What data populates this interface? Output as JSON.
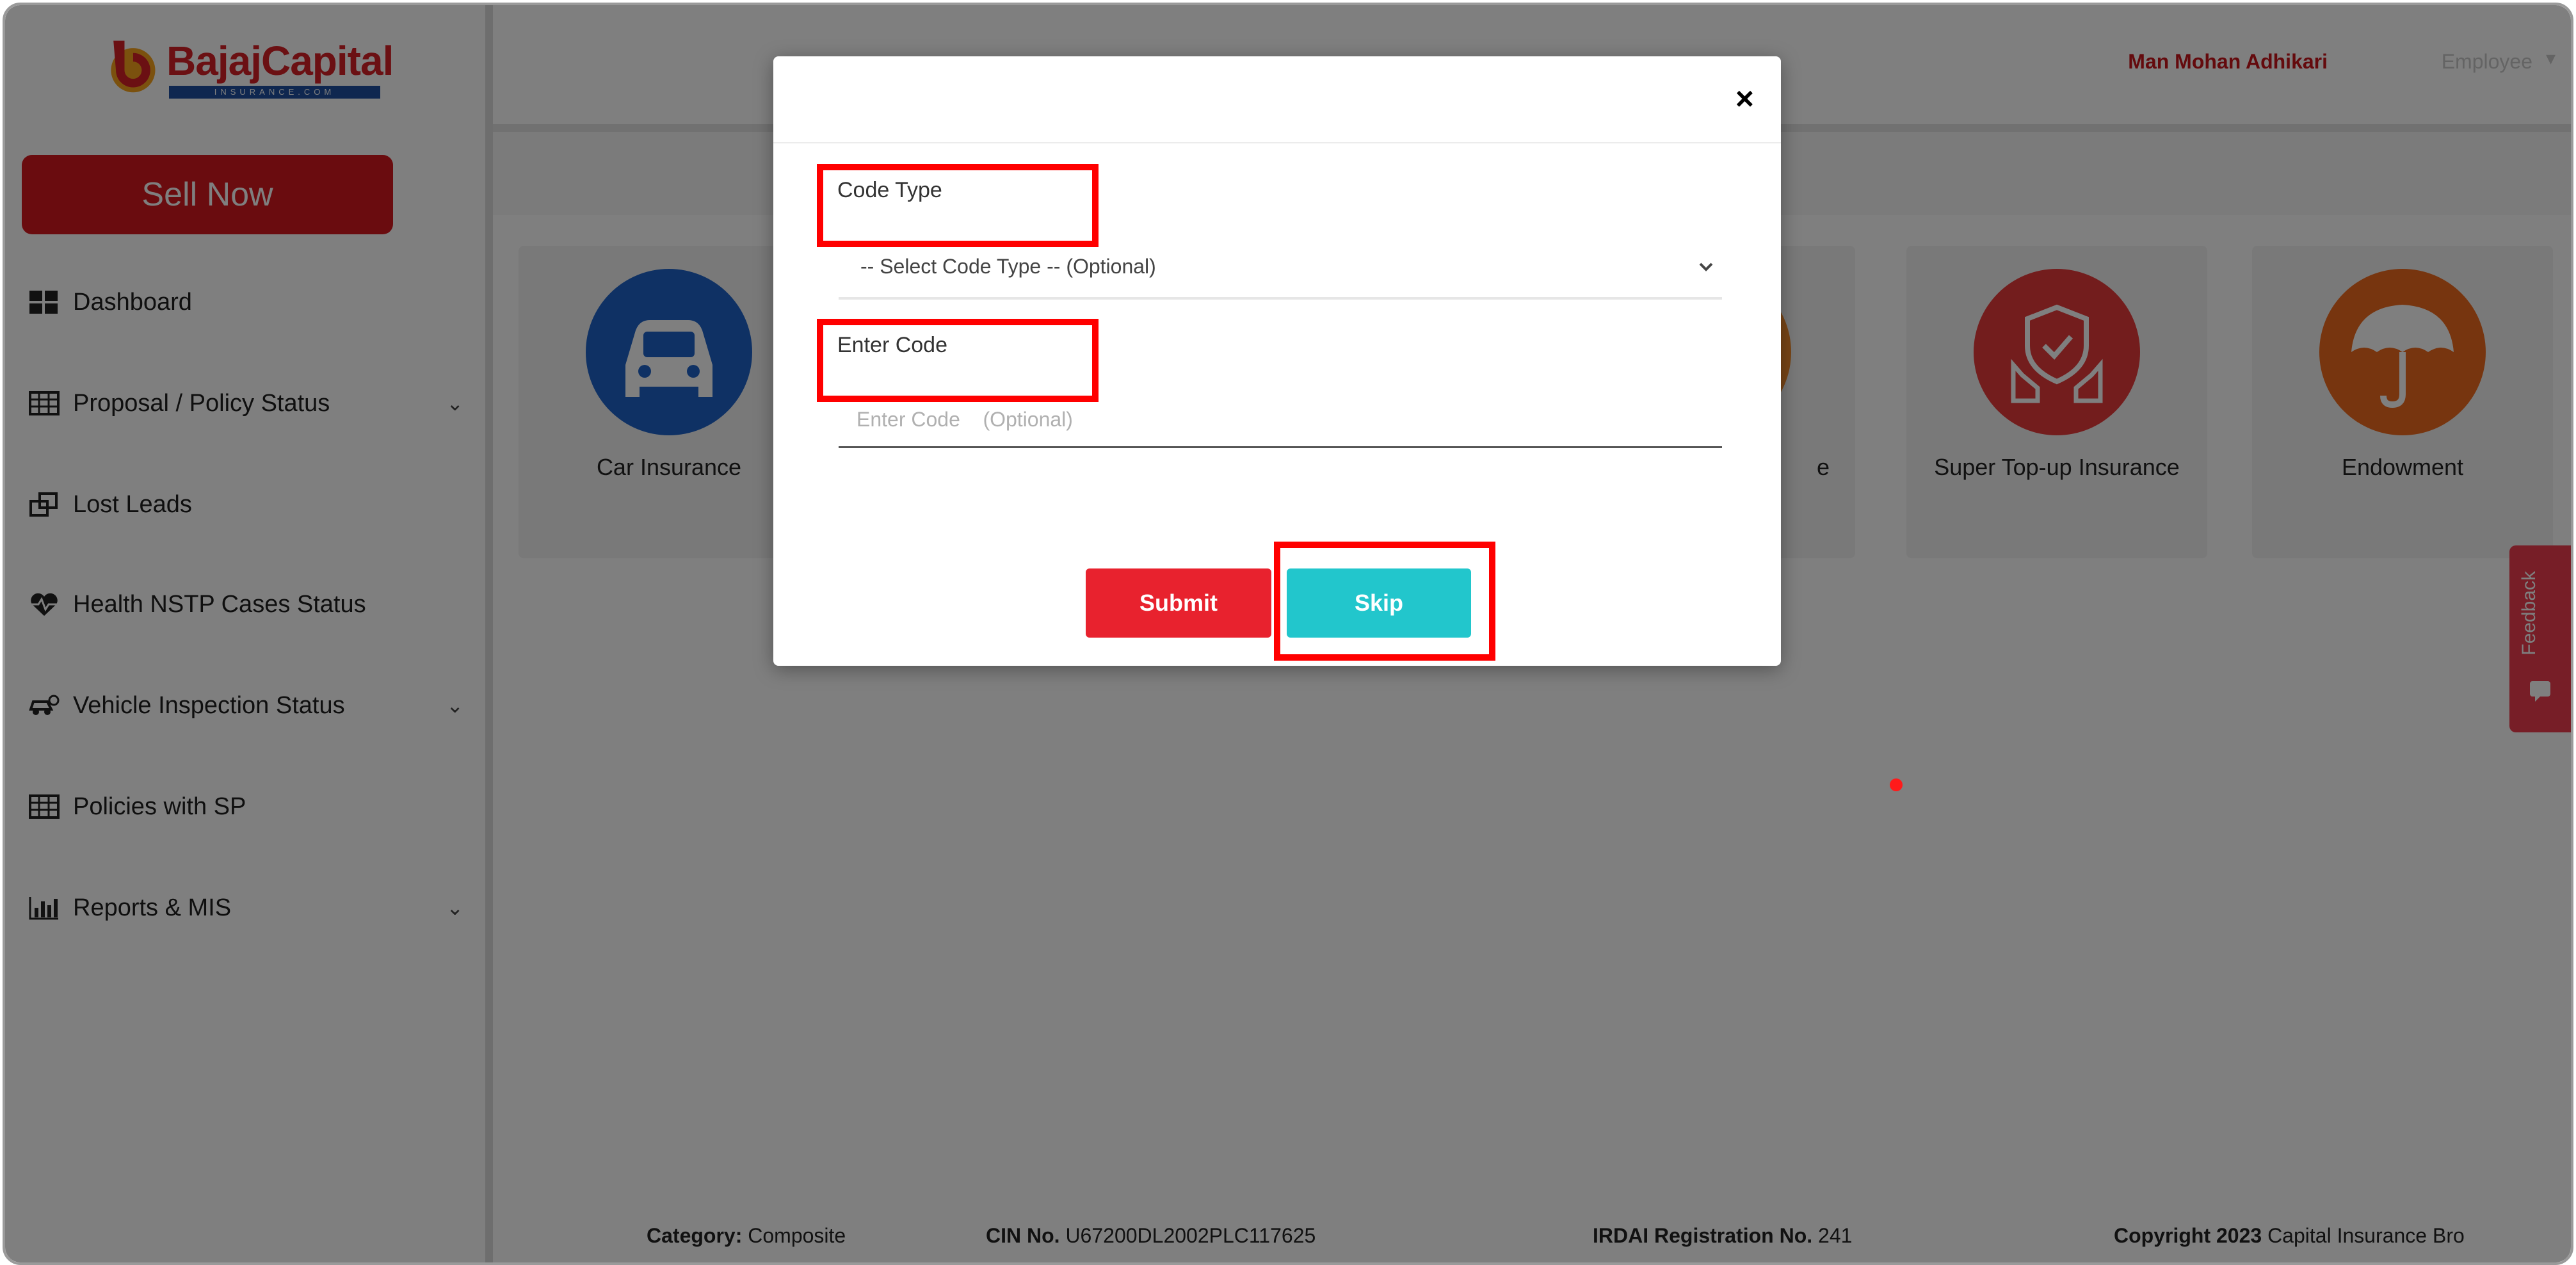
{
  "brand": {
    "name": "BajajCapital",
    "sub": "INSURANCE.COM",
    "color": "#d62027"
  },
  "sidebar": {
    "sell_now": "Sell Now",
    "items": [
      {
        "label": "Dashboard",
        "icon": "dashboard-icon",
        "has_chevron": false
      },
      {
        "label": "Proposal / Policy Status",
        "icon": "table-icon",
        "has_chevron": true
      },
      {
        "label": "Lost Leads",
        "icon": "copy-icon",
        "has_chevron": false
      },
      {
        "label": "Health NSTP Cases Status",
        "icon": "heart-pulse-icon",
        "has_chevron": false
      },
      {
        "label": "Vehicle Inspection Status",
        "icon": "car-search-icon",
        "has_chevron": true
      },
      {
        "label": "Policies with SP",
        "icon": "table-icon",
        "has_chevron": false
      },
      {
        "label": "Reports & MIS",
        "icon": "bar-chart-icon",
        "has_chevron": true
      }
    ]
  },
  "header": {
    "user_name": "Man Mohan Adhikari",
    "user_role": "Employee"
  },
  "products": [
    {
      "label": "Car Insurance",
      "icon": "car-icon",
      "color": "#1f63c8"
    },
    {
      "label": "e",
      "icon": "partial-icon",
      "color": "#f08a2c"
    },
    {
      "label": "Super Top-up Insurance",
      "icon": "shield-hands-icon",
      "color": "#e63a3a"
    },
    {
      "label": "Endowment",
      "icon": "umbrella-icon",
      "color": "#ee6a1f"
    }
  ],
  "feedback": "Feedback",
  "footer": {
    "category_label": "Category:",
    "category_value": "Composite",
    "cin_label": "CIN No.",
    "cin_value": "U67200DL2002PLC117625",
    "irdai_label": "IRDAI Registration No.",
    "irdai_value": "241",
    "copyright_label": "Copyright 2023",
    "copyright_value": "Capital Insurance Bro"
  },
  "modal": {
    "close": "×",
    "code_type_label": "Code Type",
    "code_type_placeholder": "-- Select Code Type -- (Optional)",
    "enter_code_label": "Enter Code",
    "enter_code_placeholder": "Enter Code    (Optional)",
    "submit": "Submit",
    "skip": "Skip"
  },
  "colors": {
    "highlight": "#ff0000",
    "submit": "#e8222e",
    "skip": "#22c6cc"
  }
}
